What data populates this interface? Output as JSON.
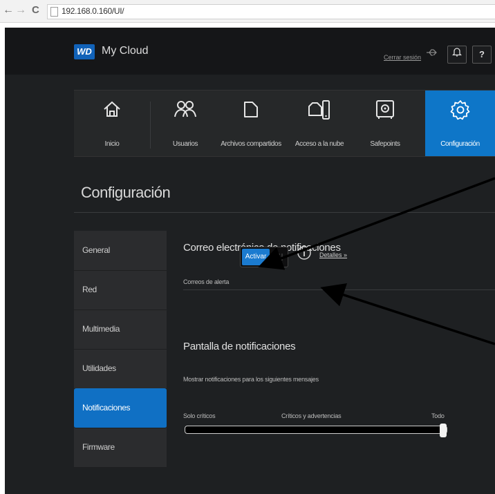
{
  "browser": {
    "back": "←",
    "forward": "→",
    "reload": "C",
    "url": "192.168.0.160/UI/"
  },
  "app": {
    "logo_mark": "WD",
    "logo_text": "My Cloud",
    "logout": "Cerrar sesión",
    "header_icons": [
      "usb-icon",
      "bell-icon",
      "help-icon"
    ],
    "help_label": "?"
  },
  "nav": [
    {
      "label": "Inicio",
      "icon": "home-icon"
    },
    {
      "label": "Usuarios",
      "icon": "users-icon"
    },
    {
      "label": "Archivos compartidos",
      "icon": "shares-icon"
    },
    {
      "label": "Acceso a la nube",
      "icon": "cloud-access-icon"
    },
    {
      "label": "Safepoints",
      "icon": "safe-icon"
    },
    {
      "label": "Configuración",
      "icon": "gear-icon",
      "active": true
    }
  ],
  "page_title": "Configuración",
  "sidebar": [
    {
      "label": "General"
    },
    {
      "label": "Red"
    },
    {
      "label": "Multimedia"
    },
    {
      "label": "Utilidades"
    },
    {
      "label": "Notificaciones",
      "active": true
    },
    {
      "label": "Firmware"
    }
  ],
  "email_section": {
    "title": "Correo electrónico de notificaciones",
    "alert_label": "Correos de alerta",
    "toggle_label": "Activar",
    "toggle_on": true,
    "details": "Detalles »"
  },
  "display_section": {
    "title": "Pantalla de notificaciones",
    "description": "Mostrar notificaciones para los siguientes mensajes",
    "levels": [
      "Solo críticos",
      "Críticos y advertencias",
      "Todo"
    ],
    "selected_level": "Todo"
  },
  "colors": {
    "accent": "#0e76c8",
    "background": "#1e2022"
  }
}
